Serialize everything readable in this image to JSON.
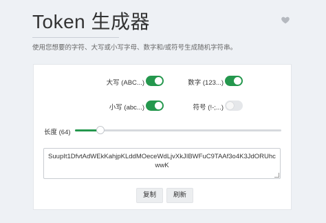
{
  "header": {
    "title": "Token 生成器",
    "subtitle": "使用您想要的字符、大写或小写字母、数字和/或符号生成随机字符串。",
    "favorite_icon": "heart-icon"
  },
  "options": {
    "uppercase": {
      "label": "大写 (ABC...)",
      "enabled": true
    },
    "numbers": {
      "label": "数字 (123...)",
      "enabled": true
    },
    "lowercase": {
      "label": "小写 (abc...)",
      "enabled": true
    },
    "symbols": {
      "label": "符号 (!-;...)",
      "enabled": false
    }
  },
  "length": {
    "label": "长度 (64)",
    "value": 64,
    "min": 1,
    "max": 512
  },
  "output": {
    "token": "SuupIt1DfvtAdWEkKahjpKLddMOeceWdLjvXkJIBWFuC9TAAf3o4K3JdORUhcwwK"
  },
  "actions": {
    "copy_label": "复制",
    "refresh_label": "刷新"
  },
  "colors": {
    "accent": "#24974d",
    "background": "#eef1f5",
    "card": "#ffffff"
  }
}
